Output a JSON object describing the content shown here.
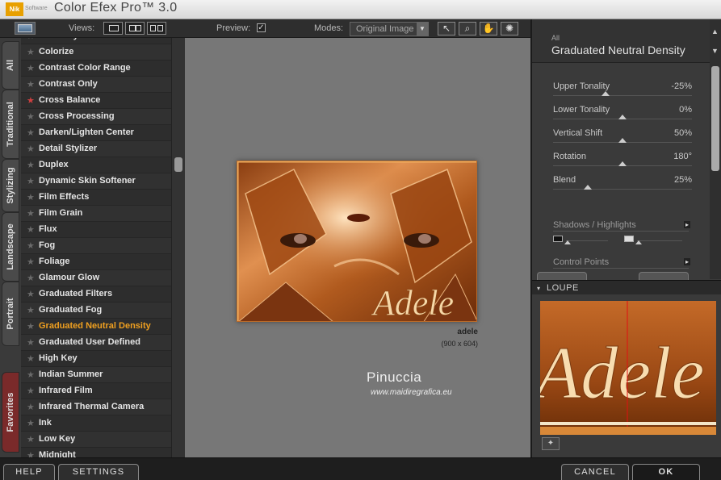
{
  "app": {
    "title": "Color Efex Pro™ 3.0",
    "logo_text": "Nik",
    "logo_sub": "Software"
  },
  "toolbar": {
    "views_label": "Views:",
    "preview_label": "Preview:",
    "preview_checked": true,
    "preview_check_glyph": "☑",
    "modes_label": "Modes:",
    "modes_value": "Original Image",
    "tools": [
      {
        "name": "arrow-tool-icon",
        "glyph": "↖"
      },
      {
        "name": "zoom-tool-icon",
        "glyph": "⌕"
      },
      {
        "name": "hand-tool-icon",
        "glyph": "✋"
      },
      {
        "name": "light-tool-icon",
        "glyph": "✺"
      }
    ]
  },
  "side_tabs": [
    "All",
    "Traditional",
    "Stylizing",
    "Landscape",
    "Portrait",
    "Favorites"
  ],
  "filters": [
    {
      "name": "Color Stylizer",
      "starred": false
    },
    {
      "name": "Colorize",
      "starred": false
    },
    {
      "name": "Contrast Color Range",
      "starred": false
    },
    {
      "name": "Contrast Only",
      "starred": false
    },
    {
      "name": "Cross Balance",
      "starred": true
    },
    {
      "name": "Cross Processing",
      "starred": false
    },
    {
      "name": "Darken/Lighten Center",
      "starred": false
    },
    {
      "name": "Detail Stylizer",
      "starred": false
    },
    {
      "name": "Duplex",
      "starred": false
    },
    {
      "name": "Dynamic Skin Softener",
      "starred": false
    },
    {
      "name": "Film Effects",
      "starred": false
    },
    {
      "name": "Film Grain",
      "starred": false
    },
    {
      "name": "Flux",
      "starred": false
    },
    {
      "name": "Fog",
      "starred": false
    },
    {
      "name": "Foliage",
      "starred": false
    },
    {
      "name": "Glamour Glow",
      "starred": false
    },
    {
      "name": "Graduated Filters",
      "starred": false
    },
    {
      "name": "Graduated Fog",
      "starred": false
    },
    {
      "name": "Graduated Neutral Density",
      "starred": false,
      "active": true
    },
    {
      "name": "Graduated User Defined",
      "starred": false
    },
    {
      "name": "High Key",
      "starred": false
    },
    {
      "name": "Indian Summer",
      "starred": false
    },
    {
      "name": "Infrared Film",
      "starred": false
    },
    {
      "name": "Infrared Thermal Camera",
      "starred": false
    },
    {
      "name": "Ink",
      "starred": false
    },
    {
      "name": "Low Key",
      "starred": false
    },
    {
      "name": "Midnight",
      "starred": false
    }
  ],
  "star_glyph": "★",
  "preview": {
    "image_name": "adele",
    "image_size": "(900 x 604)",
    "image_signature": "Adele",
    "watermark_name": "Pinuccia",
    "watermark_url": "www.maidiregrafica.eu"
  },
  "panel": {
    "category": "All",
    "filter_title": "Graduated Neutral Density",
    "params": [
      {
        "label": "Upper Tonality",
        "value": "-25%",
        "level": 0.375
      },
      {
        "label": "Lower Tonality",
        "value": "0%",
        "level": 0.5
      },
      {
        "label": "Vertical Shift",
        "value": "50%",
        "level": 0.5
      },
      {
        "label": "Rotation",
        "value": "180°",
        "level": 0.5
      },
      {
        "label": "Blend",
        "value": "25%",
        "level": 0.25
      }
    ],
    "sections": {
      "shadows_highlights": "Shadows / Highlights",
      "control_points": "Control Points"
    },
    "loupe_label": "LOUPE",
    "loupe_text": "Adele",
    "section_arrow_glyph": "▸",
    "loupe_arrow_glyph": "▾",
    "pin_glyph": "✦"
  },
  "bottom": {
    "help": "HELP",
    "settings": "SETTINGS",
    "cancel": "CANCEL",
    "ok": "OK"
  },
  "colors": {
    "accent_active": "#f0a020",
    "star_red": "#d04040",
    "image_orange": "#c26420"
  }
}
